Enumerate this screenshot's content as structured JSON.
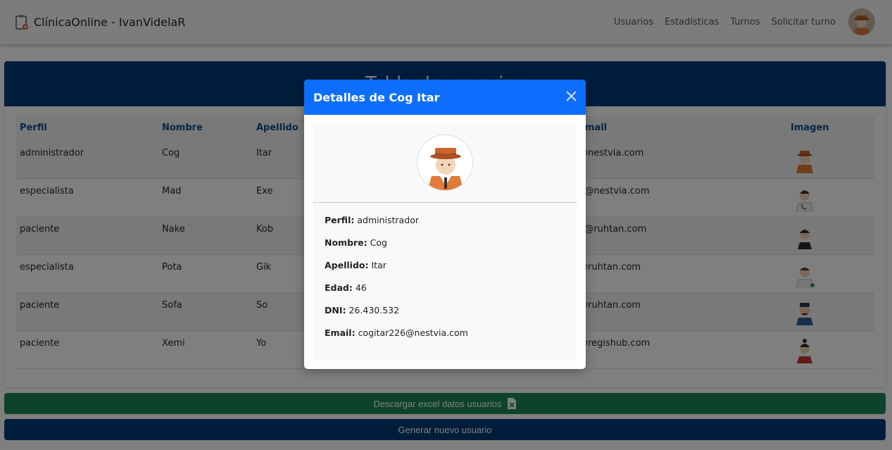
{
  "navbar": {
    "brand": "ClínicaOnline - IvanVidelaR",
    "links": [
      "Usuarios",
      "Estadísticas",
      "Turnos",
      "Solicitar turno"
    ]
  },
  "card": {
    "title": "Tabla de usuarios"
  },
  "table": {
    "headers": [
      "Perfil",
      "Nombre",
      "Apellido",
      "Email",
      "Imagen"
    ],
    "rows": [
      {
        "perfil": "administrador",
        "nombre": "Cog",
        "apellido": "Itar",
        "email": "@nestvia.com"
      },
      {
        "perfil": "especialista",
        "nombre": "Mad",
        "apellido": "Exe",
        "email": "3@nestvia.com"
      },
      {
        "perfil": "paciente",
        "nombre": "Nake",
        "apellido": "Kob",
        "email": "2@ruhtan.com"
      },
      {
        "perfil": "especialista",
        "nombre": "Pota",
        "apellido": "Gik",
        "email": "@ruhtan.com"
      },
      {
        "perfil": "paciente",
        "nombre": "Sofa",
        "apellido": "So",
        "email": "@ruhtan.com"
      },
      {
        "perfil": "paciente",
        "nombre": "Xemi",
        "apellido": "Yo",
        "email": "@regishub.com"
      }
    ]
  },
  "buttons": {
    "excel": "Descargar excel datos usuarios",
    "new_user": "Generar nuevo usuario"
  },
  "modal": {
    "title": "Detalles de Cog Itar",
    "fields": [
      {
        "label": "Perfil:",
        "value": "administrador"
      },
      {
        "label": "Nombre:",
        "value": "Cog"
      },
      {
        "label": "Apellido:",
        "value": "Itar"
      },
      {
        "label": "Edad:",
        "value": "46"
      },
      {
        "label": "DNI:",
        "value": "26.430.532"
      },
      {
        "label": "Email:",
        "value": "cogitar226@nestvia.com"
      }
    ]
  },
  "colors": {
    "primary": "#0d6efd",
    "dark_blue": "#003a78",
    "success": "#198754"
  },
  "icons": {
    "brand": "clinic-clipboard-icon",
    "close": "close-icon",
    "excel": "excel-file-icon"
  }
}
